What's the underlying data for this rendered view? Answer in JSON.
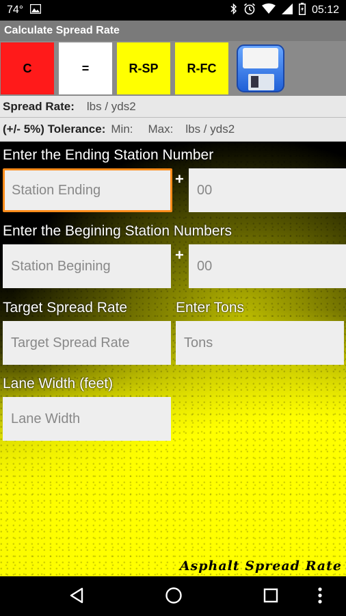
{
  "status_bar": {
    "temperature": "74°",
    "time": "05:12"
  },
  "app": {
    "title": "Calculate Spread Rate"
  },
  "buttons": {
    "clear": "C",
    "equals": "=",
    "rsp": "R-SP",
    "rfc": "R-FC"
  },
  "info": {
    "spread_rate_label": "Spread Rate:",
    "spread_rate_unit": "lbs / yds2",
    "tolerance_label": "(+/- 5%) Tolerance:",
    "min_label": "Min:",
    "max_label": "Max:",
    "tolerance_unit": "lbs / yds2"
  },
  "form": {
    "ending_label": "Enter the Ending Station Number",
    "ending_placeholder": "Station Ending",
    "ending_offset_placeholder": "00",
    "begining_label": "Enter the Begining Station Numbers",
    "begining_placeholder": "Station Begining",
    "begining_offset_placeholder": "00",
    "plus": "+",
    "target_label": "Target Spread Rate",
    "target_placeholder": "Target Spread Rate",
    "tons_label": "Enter Tons",
    "tons_placeholder": "Tons",
    "lane_label": "Lane Width (feet)",
    "lane_placeholder": "Lane Width"
  },
  "branding": {
    "text": "Asphalt Spread Rate"
  },
  "icons": {
    "save": "floppy-disk-icon",
    "back": "back-triangle-icon",
    "home": "home-circle-icon",
    "recents": "recents-square-icon",
    "menu": "overflow-menu-icon"
  },
  "colors": {
    "clear_button": "#ff1a1a",
    "equals_button": "#ffffff",
    "r_buttons": "#ffff00",
    "focus_border": "#ff8c1a",
    "title_bar": "#7a7a7a"
  }
}
